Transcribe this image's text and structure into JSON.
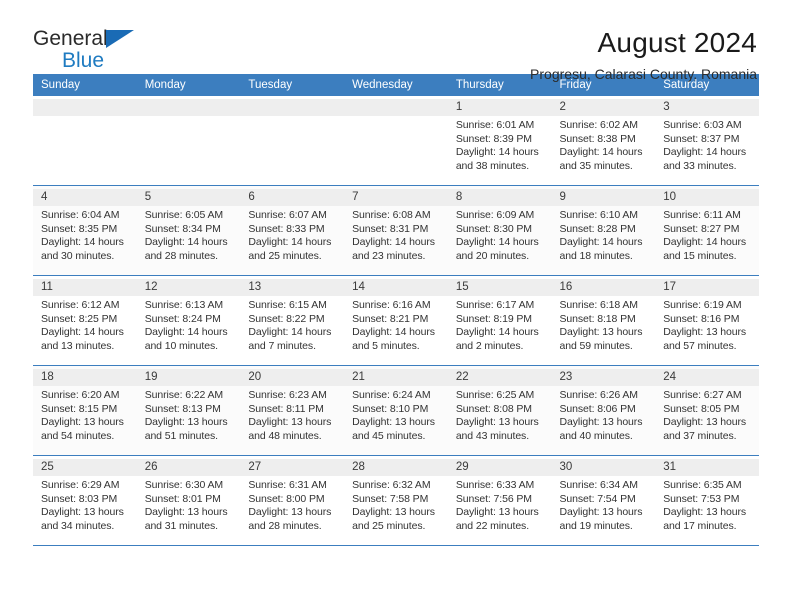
{
  "brand": {
    "name_top": "General",
    "name_bottom": "Blue",
    "triangle_color": "#1a6bb5",
    "blue_color": "#1f7bc1"
  },
  "header": {
    "title": "August 2024",
    "subtitle": "Progresu, Calarasi County, Romania"
  },
  "theme": {
    "header_bg": "#3c7ebf",
    "header_text": "#ffffff",
    "grid_line": "#3c7ebf",
    "daynum_bg": "#eeeeee",
    "alt_row_bg": "#fbfbfb"
  },
  "calendar": {
    "weekday_headers": [
      "Sunday",
      "Monday",
      "Tuesday",
      "Wednesday",
      "Thursday",
      "Friday",
      "Saturday"
    ],
    "weeks": [
      [
        {
          "day": "",
          "lines": []
        },
        {
          "day": "",
          "lines": []
        },
        {
          "day": "",
          "lines": []
        },
        {
          "day": "",
          "lines": []
        },
        {
          "day": "1",
          "lines": [
            "Sunrise: 6:01 AM",
            "Sunset: 8:39 PM",
            "Daylight: 14 hours",
            "and 38 minutes."
          ]
        },
        {
          "day": "2",
          "lines": [
            "Sunrise: 6:02 AM",
            "Sunset: 8:38 PM",
            "Daylight: 14 hours",
            "and 35 minutes."
          ]
        },
        {
          "day": "3",
          "lines": [
            "Sunrise: 6:03 AM",
            "Sunset: 8:37 PM",
            "Daylight: 14 hours",
            "and 33 minutes."
          ]
        }
      ],
      [
        {
          "day": "4",
          "lines": [
            "Sunrise: 6:04 AM",
            "Sunset: 8:35 PM",
            "Daylight: 14 hours",
            "and 30 minutes."
          ]
        },
        {
          "day": "5",
          "lines": [
            "Sunrise: 6:05 AM",
            "Sunset: 8:34 PM",
            "Daylight: 14 hours",
            "and 28 minutes."
          ]
        },
        {
          "day": "6",
          "lines": [
            "Sunrise: 6:07 AM",
            "Sunset: 8:33 PM",
            "Daylight: 14 hours",
            "and 25 minutes."
          ]
        },
        {
          "day": "7",
          "lines": [
            "Sunrise: 6:08 AM",
            "Sunset: 8:31 PM",
            "Daylight: 14 hours",
            "and 23 minutes."
          ]
        },
        {
          "day": "8",
          "lines": [
            "Sunrise: 6:09 AM",
            "Sunset: 8:30 PM",
            "Daylight: 14 hours",
            "and 20 minutes."
          ]
        },
        {
          "day": "9",
          "lines": [
            "Sunrise: 6:10 AM",
            "Sunset: 8:28 PM",
            "Daylight: 14 hours",
            "and 18 minutes."
          ]
        },
        {
          "day": "10",
          "lines": [
            "Sunrise: 6:11 AM",
            "Sunset: 8:27 PM",
            "Daylight: 14 hours",
            "and 15 minutes."
          ]
        }
      ],
      [
        {
          "day": "11",
          "lines": [
            "Sunrise: 6:12 AM",
            "Sunset: 8:25 PM",
            "Daylight: 14 hours",
            "and 13 minutes."
          ]
        },
        {
          "day": "12",
          "lines": [
            "Sunrise: 6:13 AM",
            "Sunset: 8:24 PM",
            "Daylight: 14 hours",
            "and 10 minutes."
          ]
        },
        {
          "day": "13",
          "lines": [
            "Sunrise: 6:15 AM",
            "Sunset: 8:22 PM",
            "Daylight: 14 hours",
            "and 7 minutes."
          ]
        },
        {
          "day": "14",
          "lines": [
            "Sunrise: 6:16 AM",
            "Sunset: 8:21 PM",
            "Daylight: 14 hours",
            "and 5 minutes."
          ]
        },
        {
          "day": "15",
          "lines": [
            "Sunrise: 6:17 AM",
            "Sunset: 8:19 PM",
            "Daylight: 14 hours",
            "and 2 minutes."
          ]
        },
        {
          "day": "16",
          "lines": [
            "Sunrise: 6:18 AM",
            "Sunset: 8:18 PM",
            "Daylight: 13 hours",
            "and 59 minutes."
          ]
        },
        {
          "day": "17",
          "lines": [
            "Sunrise: 6:19 AM",
            "Sunset: 8:16 PM",
            "Daylight: 13 hours",
            "and 57 minutes."
          ]
        }
      ],
      [
        {
          "day": "18",
          "lines": [
            "Sunrise: 6:20 AM",
            "Sunset: 8:15 PM",
            "Daylight: 13 hours",
            "and 54 minutes."
          ]
        },
        {
          "day": "19",
          "lines": [
            "Sunrise: 6:22 AM",
            "Sunset: 8:13 PM",
            "Daylight: 13 hours",
            "and 51 minutes."
          ]
        },
        {
          "day": "20",
          "lines": [
            "Sunrise: 6:23 AM",
            "Sunset: 8:11 PM",
            "Daylight: 13 hours",
            "and 48 minutes."
          ]
        },
        {
          "day": "21",
          "lines": [
            "Sunrise: 6:24 AM",
            "Sunset: 8:10 PM",
            "Daylight: 13 hours",
            "and 45 minutes."
          ]
        },
        {
          "day": "22",
          "lines": [
            "Sunrise: 6:25 AM",
            "Sunset: 8:08 PM",
            "Daylight: 13 hours",
            "and 43 minutes."
          ]
        },
        {
          "day": "23",
          "lines": [
            "Sunrise: 6:26 AM",
            "Sunset: 8:06 PM",
            "Daylight: 13 hours",
            "and 40 minutes."
          ]
        },
        {
          "day": "24",
          "lines": [
            "Sunrise: 6:27 AM",
            "Sunset: 8:05 PM",
            "Daylight: 13 hours",
            "and 37 minutes."
          ]
        }
      ],
      [
        {
          "day": "25",
          "lines": [
            "Sunrise: 6:29 AM",
            "Sunset: 8:03 PM",
            "Daylight: 13 hours",
            "and 34 minutes."
          ]
        },
        {
          "day": "26",
          "lines": [
            "Sunrise: 6:30 AM",
            "Sunset: 8:01 PM",
            "Daylight: 13 hours",
            "and 31 minutes."
          ]
        },
        {
          "day": "27",
          "lines": [
            "Sunrise: 6:31 AM",
            "Sunset: 8:00 PM",
            "Daylight: 13 hours",
            "and 28 minutes."
          ]
        },
        {
          "day": "28",
          "lines": [
            "Sunrise: 6:32 AM",
            "Sunset: 7:58 PM",
            "Daylight: 13 hours",
            "and 25 minutes."
          ]
        },
        {
          "day": "29",
          "lines": [
            "Sunrise: 6:33 AM",
            "Sunset: 7:56 PM",
            "Daylight: 13 hours",
            "and 22 minutes."
          ]
        },
        {
          "day": "30",
          "lines": [
            "Sunrise: 6:34 AM",
            "Sunset: 7:54 PM",
            "Daylight: 13 hours",
            "and 19 minutes."
          ]
        },
        {
          "day": "31",
          "lines": [
            "Sunrise: 6:35 AM",
            "Sunset: 7:53 PM",
            "Daylight: 13 hours",
            "and 17 minutes."
          ]
        }
      ]
    ]
  }
}
